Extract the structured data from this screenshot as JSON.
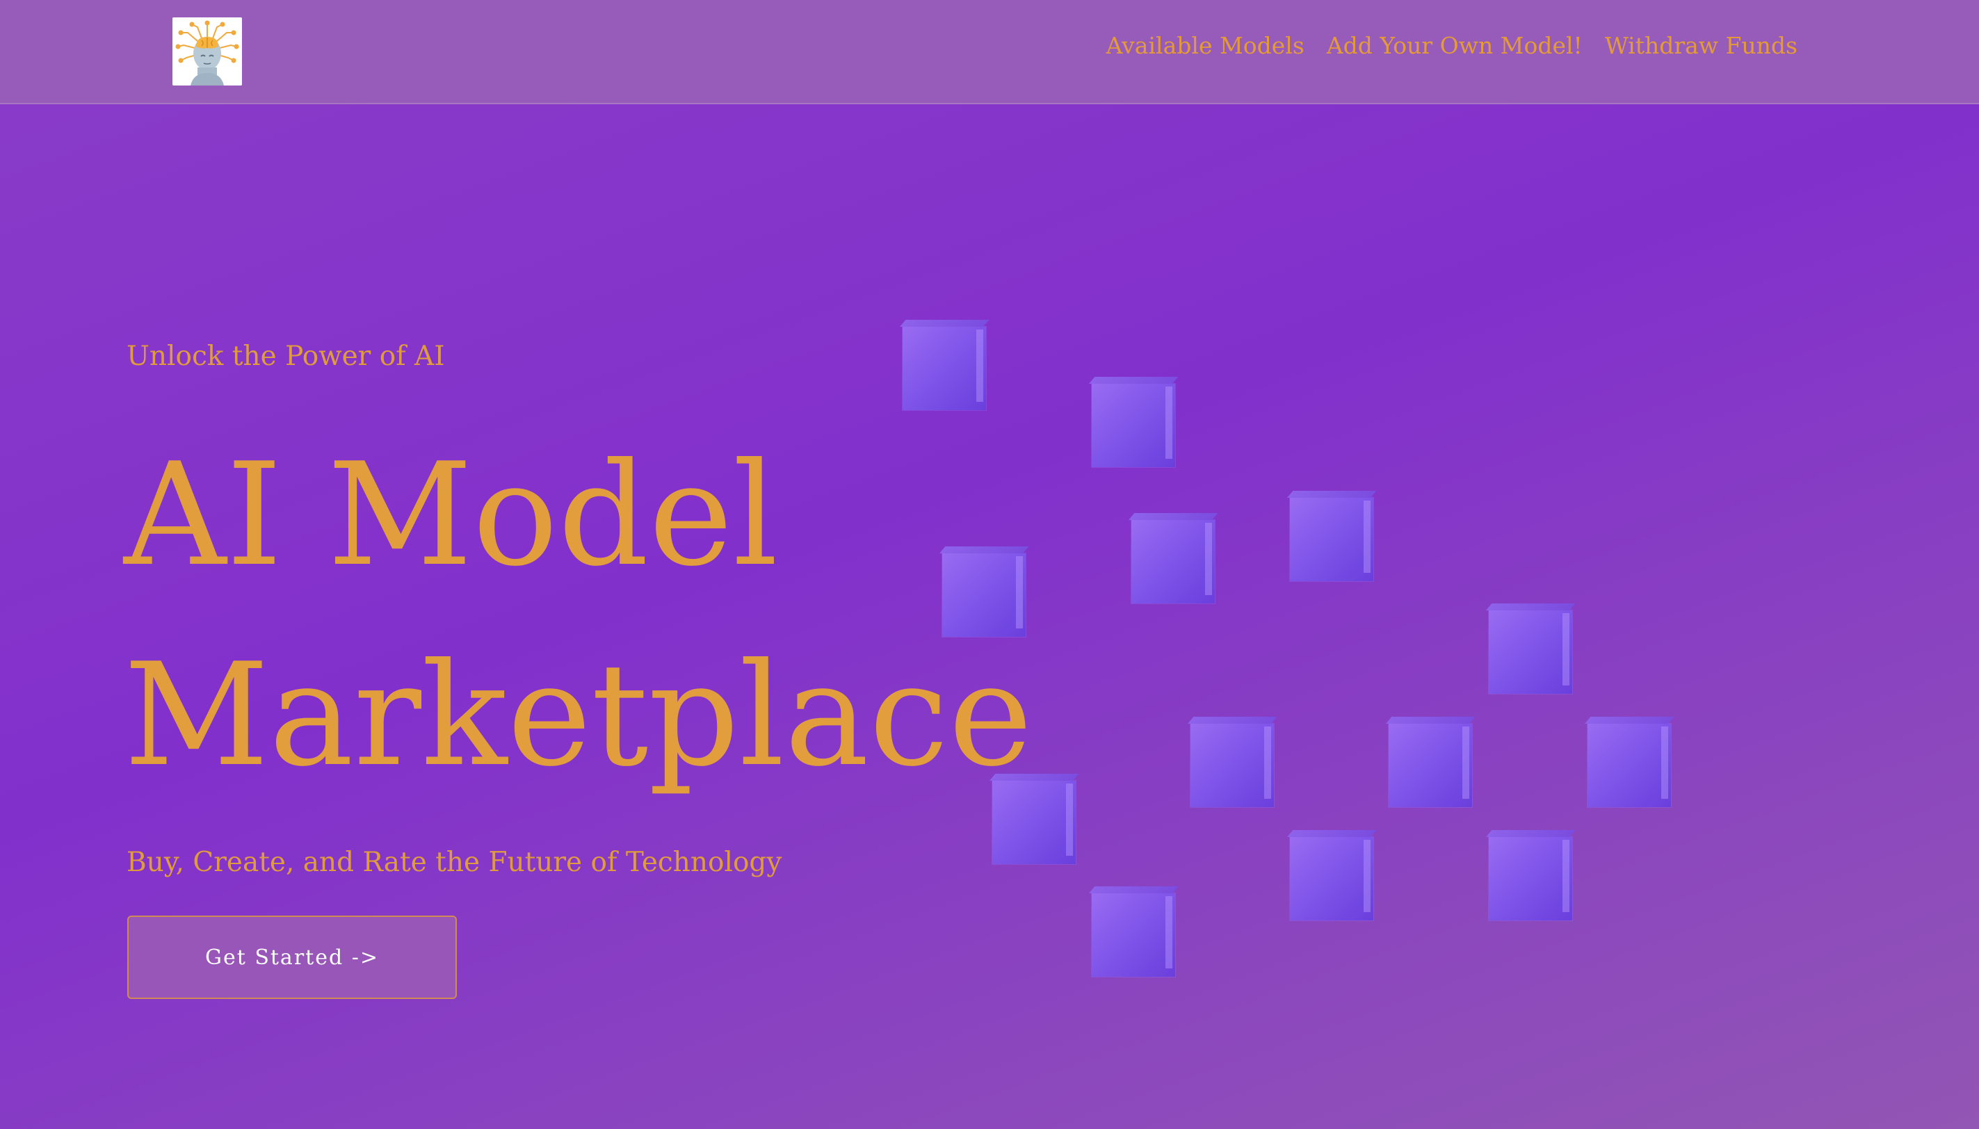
{
  "nav": {
    "links": [
      "Available Models",
      "Add Your Own Model!",
      "Withdraw Funds"
    ]
  },
  "hero": {
    "eyebrow": "Unlock the Power of AI",
    "headline_line1": "AI Model",
    "headline_line2": "Marketplace",
    "subtitle": "Buy, Create, and Rate the Future of Technology",
    "cta_label": "Get Started ->"
  },
  "colors": {
    "accent": "#e29e3c",
    "navbar": "#975cba",
    "background": "#8230cc",
    "cube": "#7c52e8"
  },
  "icons": {
    "logo": "ai-head-logo-icon",
    "decoration": "cube-icon"
  }
}
